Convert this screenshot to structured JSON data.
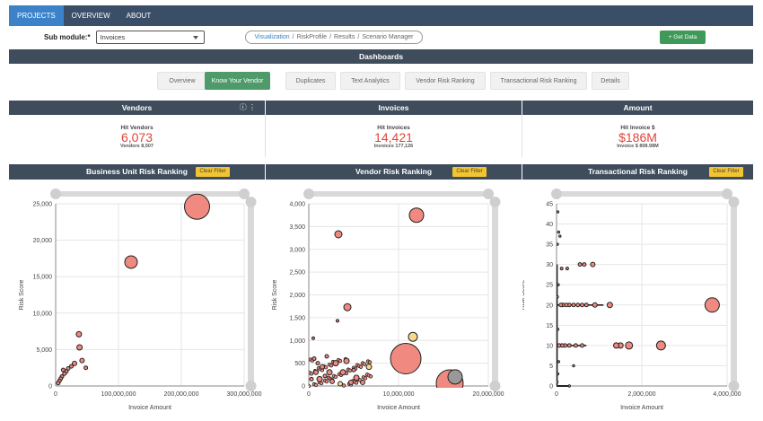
{
  "nav": {
    "items": [
      {
        "label": "PROJECTS",
        "active": true
      },
      {
        "label": "OVERVIEW",
        "active": false
      },
      {
        "label": "ABOUT",
        "active": false
      }
    ]
  },
  "submodule": {
    "label": "Sub module:*",
    "value": "Invoices"
  },
  "breadcrumb": {
    "items": [
      "Visualization",
      "RiskProfile",
      "Results",
      "Scenario Manager"
    ],
    "separator": "/"
  },
  "get_data_label": "+ Get Data",
  "dashboard_title": "Dashboards",
  "tabs": [
    {
      "label": "Overview",
      "active": false
    },
    {
      "label": "Know Your Vendor",
      "active": true
    },
    {
      "label": "Duplicates",
      "active": false
    },
    {
      "label": "Text Analytics",
      "active": false
    },
    {
      "label": "Vendor Risk Ranking",
      "active": false
    },
    {
      "label": "Transactional Risk Ranking",
      "active": false
    },
    {
      "label": "Details",
      "active": false
    }
  ],
  "kpis": [
    {
      "title": "Vendors",
      "subtitle": "Hit Vendors",
      "value": "6,073",
      "footer": "Vendors 8,507",
      "icons": "ⓘ ⋮"
    },
    {
      "title": "Invoices",
      "subtitle": "Hit Invoices",
      "value": "14,421",
      "footer": "Invoices 177,126",
      "icons": ""
    },
    {
      "title": "Amount",
      "subtitle": "Hit Invoice $",
      "value": "$186M",
      "footer": "Invoice $ 808.98M",
      "icons": ""
    }
  ],
  "clear_filter_label": "Clear Filter",
  "colors": {
    "nav_bg": "#3b4e68",
    "nav_active": "#3c82c9",
    "header_bg": "#3f4c5c",
    "tab_active": "#4e9a6b",
    "kpi_value": "#e0443a",
    "clear_filter": "#f2c530",
    "bubble": "#f08a80",
    "bubble_yellow": "#f6d98a",
    "bubble_gray": "#999999",
    "scroll_track": "#d9d9d9"
  },
  "chart_data": [
    {
      "type": "scatter",
      "title": "Business Unit Risk Ranking",
      "xlabel": "Invoice Amount",
      "ylabel": "Risk Score",
      "xlim": [
        0,
        300000000
      ],
      "ylim": [
        0,
        25000
      ],
      "xticks": [
        "0",
        "100,000,000",
        "200,000,000",
        "300,000,000"
      ],
      "xtick_values": [
        0,
        100000000,
        200000000,
        300000000
      ],
      "yticks": [
        "0",
        "5,000",
        "10,000",
        "15,000",
        "20,000",
        "25,000"
      ],
      "ytick_values": [
        0,
        5000,
        10000,
        15000,
        20000,
        25000
      ],
      "grid": true,
      "points": [
        {
          "x": 225000000,
          "y": 24600,
          "r": 14,
          "color": "pink"
        },
        {
          "x": 120000000,
          "y": 17000,
          "r": 7,
          "color": "pink"
        },
        {
          "x": 37000000,
          "y": 7100,
          "r": 3,
          "color": "pink"
        },
        {
          "x": 38000000,
          "y": 5300,
          "r": 3,
          "color": "pink"
        },
        {
          "x": 42000000,
          "y": 3500,
          "r": 2.5,
          "color": "pink"
        },
        {
          "x": 30000000,
          "y": 3100,
          "r": 2.5,
          "color": "pink"
        },
        {
          "x": 25000000,
          "y": 2700,
          "r": 2,
          "color": "pink"
        },
        {
          "x": 20000000,
          "y": 2400,
          "r": 2,
          "color": "pink"
        },
        {
          "x": 17000000,
          "y": 2000,
          "r": 2,
          "color": "pink"
        },
        {
          "x": 14000000,
          "y": 1700,
          "r": 2,
          "color": "pink"
        },
        {
          "x": 10000000,
          "y": 1300,
          "r": 2,
          "color": "pink"
        },
        {
          "x": 8000000,
          "y": 1000,
          "r": 2,
          "color": "pink"
        },
        {
          "x": 6000000,
          "y": 700,
          "r": 2,
          "color": "pink"
        },
        {
          "x": 4000000,
          "y": 400,
          "r": 2,
          "color": "pink"
        },
        {
          "x": 48000000,
          "y": 2500,
          "r": 2,
          "color": "pink"
        },
        {
          "x": 12000000,
          "y": 2200,
          "r": 2,
          "color": "pink"
        }
      ]
    },
    {
      "type": "scatter",
      "title": "Vendor Risk Ranking",
      "xlabel": "Invoice Amount",
      "ylabel": "Risk Score",
      "xlim": [
        0,
        20000000
      ],
      "ylim": [
        0,
        4000
      ],
      "xticks": [
        "0",
        "10,000,000",
        "20,000,000"
      ],
      "xtick_values": [
        0,
        10000000,
        20000000
      ],
      "yticks": [
        "0",
        "500",
        "1,000",
        "1,500",
        "2,000",
        "2,500",
        "3,000",
        "3,500",
        "4,000"
      ],
      "ytick_values": [
        0,
        500,
        1000,
        1500,
        2000,
        2500,
        3000,
        3500,
        4000
      ],
      "grid": true,
      "points": [
        {
          "x": 12000000,
          "y": 3750,
          "r": 8,
          "color": "pink"
        },
        {
          "x": 3300000,
          "y": 3330,
          "r": 4,
          "color": "pink"
        },
        {
          "x": 4300000,
          "y": 1730,
          "r": 4,
          "color": "pink"
        },
        {
          "x": 3200000,
          "y": 1430,
          "r": 1.5,
          "color": "pink"
        },
        {
          "x": 11600000,
          "y": 1080,
          "r": 5,
          "color": "yellow"
        },
        {
          "x": 10800000,
          "y": 600,
          "r": 17,
          "color": "pink"
        },
        {
          "x": 15700000,
          "y": 60,
          "r": 15,
          "color": "pink"
        },
        {
          "x": 16300000,
          "y": 200,
          "r": 8,
          "color": "gray"
        },
        {
          "x": 500000,
          "y": 1050,
          "r": 1.5,
          "color": "pink"
        },
        {
          "x": 1200000,
          "y": 150,
          "r": 3,
          "color": "pink"
        },
        {
          "x": 2300000,
          "y": 300,
          "r": 3,
          "color": "pink"
        },
        {
          "x": 3000000,
          "y": 500,
          "r": 3,
          "color": "pink"
        },
        {
          "x": 3800000,
          "y": 300,
          "r": 3,
          "color": "pink"
        },
        {
          "x": 4200000,
          "y": 550,
          "r": 3,
          "color": "pink"
        },
        {
          "x": 5300000,
          "y": 180,
          "r": 3,
          "color": "pink"
        },
        {
          "x": 6700000,
          "y": 420,
          "r": 3,
          "color": "yellow"
        },
        {
          "x": 1500000,
          "y": 420,
          "r": 2.5,
          "color": "pink"
        },
        {
          "x": 2600000,
          "y": 100,
          "r": 2.5,
          "color": "pink"
        },
        {
          "x": 800000,
          "y": 300,
          "r": 2.5,
          "color": "pink"
        },
        {
          "x": 4700000,
          "y": 80,
          "r": 2.5,
          "color": "pink"
        },
        {
          "x": 6000000,
          "y": 80,
          "r": 2.5,
          "color": "pink"
        },
        {
          "x": 3500000,
          "y": 50,
          "r": 2.5,
          "color": "yellow"
        },
        {
          "x": 5000000,
          "y": 350,
          "r": 2,
          "color": "pink"
        },
        {
          "x": 1800000,
          "y": 220,
          "r": 2,
          "color": "pink"
        },
        {
          "x": 300000,
          "y": 150,
          "r": 2,
          "color": "pink"
        },
        {
          "x": 2000000,
          "y": 650,
          "r": 2,
          "color": "pink"
        },
        {
          "x": 600000,
          "y": 600,
          "r": 2,
          "color": "pink"
        },
        {
          "x": 1000000,
          "y": 500,
          "r": 2,
          "color": "pink"
        }
      ]
    },
    {
      "type": "scatter",
      "title": "Transactional Risk Ranking",
      "xlabel": "Invoice Amount",
      "ylabel": "Risk Score",
      "xlim": [
        0,
        4000000
      ],
      "ylim": [
        0,
        45
      ],
      "xticks": [
        "0",
        "2,000,000",
        "4,000,000"
      ],
      "xtick_values": [
        0,
        2000000,
        4000000
      ],
      "yticks": [
        "0",
        "5",
        "10",
        "15",
        "20",
        "25",
        "30",
        "35",
        "40",
        "45"
      ],
      "ytick_values": [
        0,
        5,
        10,
        15,
        20,
        25,
        30,
        35,
        40,
        45
      ],
      "grid": true,
      "points": [
        {
          "x": 3650000,
          "y": 20,
          "r": 8,
          "color": "pink"
        },
        {
          "x": 2450000,
          "y": 10,
          "r": 5,
          "color": "pink"
        },
        {
          "x": 1700000,
          "y": 10,
          "r": 4,
          "color": "pink"
        },
        {
          "x": 1500000,
          "y": 10,
          "r": 3,
          "color": "pink"
        },
        {
          "x": 1400000,
          "y": 10,
          "r": 3,
          "color": "pink"
        },
        {
          "x": 1250000,
          "y": 20,
          "r": 3,
          "color": "pink"
        },
        {
          "x": 900000,
          "y": 20,
          "r": 2.5,
          "color": "pink"
        },
        {
          "x": 700000,
          "y": 20,
          "r": 2,
          "color": "pink"
        },
        {
          "x": 600000,
          "y": 20,
          "r": 2,
          "color": "pink"
        },
        {
          "x": 500000,
          "y": 20,
          "r": 2,
          "color": "pink"
        },
        {
          "x": 400000,
          "y": 20,
          "r": 2,
          "color": "pink"
        },
        {
          "x": 300000,
          "y": 20,
          "r": 2,
          "color": "pink"
        },
        {
          "x": 230000,
          "y": 20,
          "r": 2,
          "color": "pink"
        },
        {
          "x": 150000,
          "y": 20,
          "r": 2,
          "color": "pink"
        },
        {
          "x": 100000,
          "y": 20,
          "r": 2,
          "color": "pink"
        },
        {
          "x": 600000,
          "y": 10,
          "r": 2,
          "color": "pink"
        },
        {
          "x": 450000,
          "y": 10,
          "r": 2,
          "color": "pink"
        },
        {
          "x": 300000,
          "y": 10,
          "r": 2,
          "color": "pink"
        },
        {
          "x": 200000,
          "y": 10,
          "r": 2,
          "color": "pink"
        },
        {
          "x": 130000,
          "y": 10,
          "r": 2,
          "color": "pink"
        },
        {
          "x": 60000,
          "y": 10,
          "r": 2,
          "color": "pink"
        },
        {
          "x": 850000,
          "y": 30,
          "r": 2.5,
          "color": "pink"
        },
        {
          "x": 650000,
          "y": 30,
          "r": 2,
          "color": "pink"
        },
        {
          "x": 550000,
          "y": 30,
          "r": 2,
          "color": "pink"
        },
        {
          "x": 250000,
          "y": 29,
          "r": 1.5,
          "color": "pink"
        },
        {
          "x": 120000,
          "y": 29,
          "r": 1.5,
          "color": "pink"
        },
        {
          "x": 30000,
          "y": 43,
          "r": 1.2,
          "color": "pink"
        },
        {
          "x": 50000,
          "y": 38,
          "r": 1.2,
          "color": "pink"
        },
        {
          "x": 80000,
          "y": 37,
          "r": 1.2,
          "color": "pink"
        },
        {
          "x": 20000,
          "y": 35,
          "r": 1.2,
          "color": "pink"
        },
        {
          "x": 40000,
          "y": 25,
          "r": 1.2,
          "color": "pink"
        },
        {
          "x": 20000,
          "y": 22,
          "r": 1.2,
          "color": "pink"
        },
        {
          "x": 30000,
          "y": 14,
          "r": 1.2,
          "color": "pink"
        },
        {
          "x": 50000,
          "y": 6,
          "r": 1.2,
          "color": "pink"
        },
        {
          "x": 30000,
          "y": 3,
          "r": 1.2,
          "color": "pink"
        },
        {
          "x": 10000,
          "y": 1,
          "r": 1.2,
          "color": "pink"
        },
        {
          "x": 400000,
          "y": 5,
          "r": 1.2,
          "color": "pink"
        },
        {
          "x": 300000,
          "y": 0,
          "r": 1.2,
          "color": "pink"
        }
      ]
    }
  ]
}
